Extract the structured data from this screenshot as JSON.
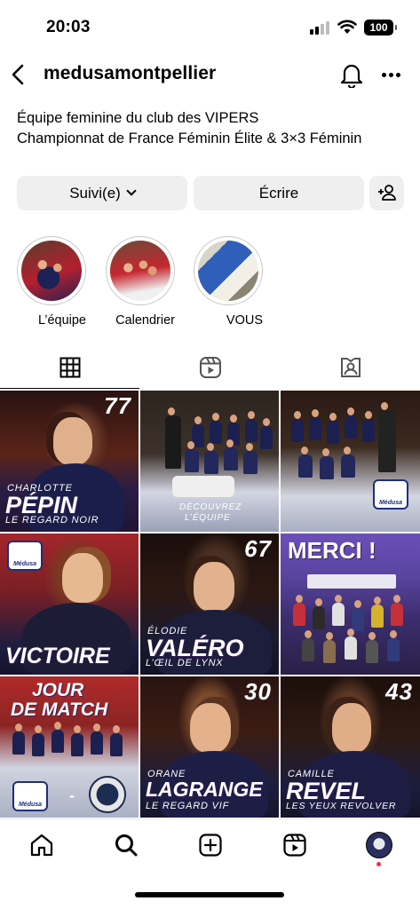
{
  "status_bar": {
    "time": "20:03",
    "battery": "100"
  },
  "header": {
    "username": "medusamontpellier",
    "icons": [
      "back-chevron-icon",
      "bell-icon",
      "more-icon"
    ]
  },
  "bio": {
    "line1": "Équipe feminine du club des VIPERS",
    "line2": "Championnat de France Féminin Élite & 3×3 Féminin"
  },
  "actions": {
    "follow_label": "Suivi(e)",
    "write_label": "Écrire",
    "add_user_icon": "add-user-icon"
  },
  "highlights": [
    {
      "label": "L’équipe"
    },
    {
      "label": "Calendrier"
    },
    {
      "label": "VOUS"
    }
  ],
  "tabs": [
    {
      "icon": "grid-icon",
      "active": true
    },
    {
      "icon": "reels-icon",
      "active": false
    },
    {
      "icon": "tagged-icon",
      "active": false
    }
  ],
  "posts": [
    {
      "number": "77",
      "first": "Charlotte",
      "last": "Pépin",
      "tagline": "Le regard noir"
    },
    {
      "line1": "Découvrez",
      "line2": "l’équipe"
    },
    {
      "logo": "Médusa"
    },
    {
      "logo": "Médusa",
      "title": "Victoire"
    },
    {
      "number": "67",
      "first": "Élodie",
      "last": "Valéro",
      "tagline": "L’œil de lynx"
    },
    {
      "title": "Merci !"
    },
    {
      "title1": "Jour",
      "title2": "de match",
      "logo": "Médusa",
      "dash": "-"
    },
    {
      "number": "30",
      "first": "Orane",
      "last": "Lagrange",
      "tagline": "Le regard vif"
    },
    {
      "number": "43",
      "first": "Camille",
      "last": "Revel",
      "tagline": "Les yeux revolver"
    }
  ],
  "bottom_nav": [
    "home-icon",
    "search-icon",
    "create-icon",
    "reels-icon",
    "profile-avatar"
  ],
  "colors": {
    "button_bg": "#efefef",
    "brand_navy": "#1f2f7a",
    "notification_dot": "#ef2b4a"
  }
}
